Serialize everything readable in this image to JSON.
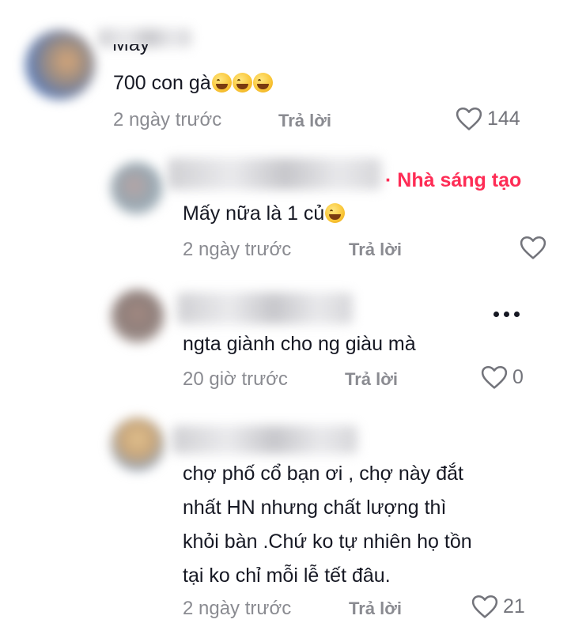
{
  "comments": [
    {
      "name_partial": "May",
      "text": "700 con gà",
      "time": "2 ngày trước",
      "reply": "Trả lời",
      "likes": "144"
    },
    {
      "creator_badge": "· Nhà sáng tạo",
      "text": "Mấy nữa là 1 củ",
      "time": "2 ngày trước",
      "reply": "Trả lời"
    },
    {
      "text": "ngta giành cho ng giàu mà",
      "time": "20 giờ trước",
      "reply": "Trả lời",
      "likes": "0"
    },
    {
      "lines": [
        "chợ phố cổ bạn ơi , chợ này đắt",
        "nhất HN nhưng chất lượng thì",
        "khỏi bàn .Chứ ko tự nhiên họ tồn",
        "tại ko chỉ mỗi lễ tết đâu."
      ],
      "time": "2 ngày trước",
      "reply": "Trả lời",
      "likes": "21"
    }
  ],
  "icons": {
    "emoji": "grinning-sweat-emoji",
    "like": "heart-outline-icon",
    "more": "more-dots-icon"
  },
  "colors": {
    "creator": "#fe2c55",
    "secondary_text": "#8a8b91"
  }
}
